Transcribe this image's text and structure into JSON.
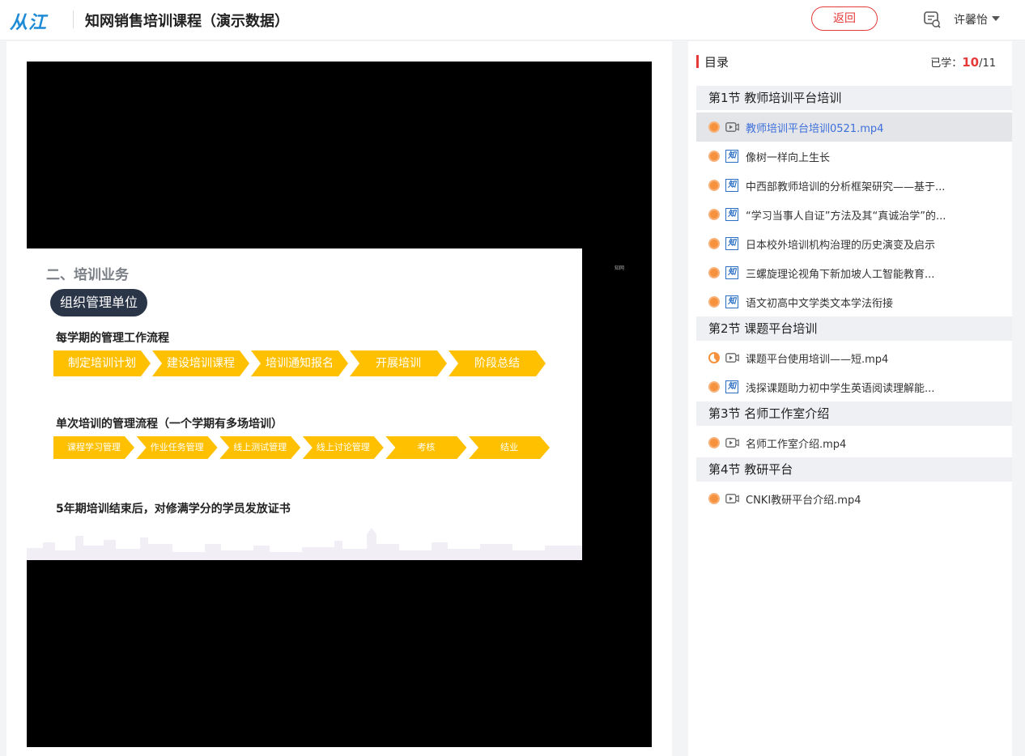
{
  "header": {
    "logo": "从江",
    "title": "知网销售培训课程（演示数据）",
    "back_label": "返回",
    "user_name": "许馨怡"
  },
  "slide": {
    "heading": "二、培训业务",
    "pill": "组织管理单位",
    "flow1_title": "每学期的管理工作流程",
    "flow1_steps": [
      "制定培训计划",
      "建设培训课程",
      "培训通知报名",
      "开展培训",
      "阶段总结"
    ],
    "flow2_title": "单次培训的管理流程（一个学期有多场培训）",
    "flow2_steps": [
      "课程学习管理",
      "作业任务管理",
      "线上测试管理",
      "线上讨论管理",
      "考核",
      "结业"
    ],
    "certificate": "5年期培训结束后，对修满学分的学员发放证书",
    "watermark": "知网"
  },
  "sidebar": {
    "toc_label": "目录",
    "learned_prefix": "已学：",
    "learned_current": "10",
    "learned_total": "/11",
    "sections": [
      {
        "title": "第1节 教师培训平台培训",
        "items": [
          {
            "label": "教师培训平台培训0521.mp4",
            "type": "video",
            "status": "done",
            "active": true
          },
          {
            "label": "像树一样向上生长",
            "type": "doc",
            "status": "done",
            "active": false
          },
          {
            "label": "中西部教师培训的分析框架研究——基于...",
            "type": "doc",
            "status": "done",
            "active": false
          },
          {
            "label": "“学习当事人自证”方法及其“真诚治学”的...",
            "type": "doc",
            "status": "done",
            "active": false
          },
          {
            "label": "日本校外培训机构治理的历史演变及启示",
            "type": "doc",
            "status": "done",
            "active": false
          },
          {
            "label": "三螺旋理论视角下新加坡人工智能教育...",
            "type": "doc",
            "status": "done",
            "active": false
          },
          {
            "label": "语文初高中文学类文本学法衔接",
            "type": "doc",
            "status": "done",
            "active": false
          }
        ]
      },
      {
        "title": "第2节 课题平台培训",
        "items": [
          {
            "label": "课题平台使用培训——短.mp4",
            "type": "video",
            "status": "partial",
            "active": false
          },
          {
            "label": "浅探课题助力初中学生英语阅读理解能...",
            "type": "doc",
            "status": "done",
            "active": false
          }
        ]
      },
      {
        "title": "第3节 名师工作室介绍",
        "items": [
          {
            "label": "名师工作室介绍.mp4",
            "type": "video",
            "status": "done",
            "active": false
          }
        ]
      },
      {
        "title": "第4节 教研平台",
        "items": [
          {
            "label": "CNKI教研平台介绍.mp4",
            "type": "video",
            "status": "done",
            "active": false
          }
        ]
      }
    ]
  },
  "icons": {
    "video": "video-icon",
    "doc": "zhi-doc-icon",
    "message": "message-icon",
    "caret": "caret-down-icon"
  },
  "colors": {
    "accent_red": "#e63b3b",
    "progress_orange": "#f6923d",
    "active_blue": "#3d6fdc",
    "flow_yellow": "#ffc000",
    "pill_navy": "#2b3548"
  }
}
